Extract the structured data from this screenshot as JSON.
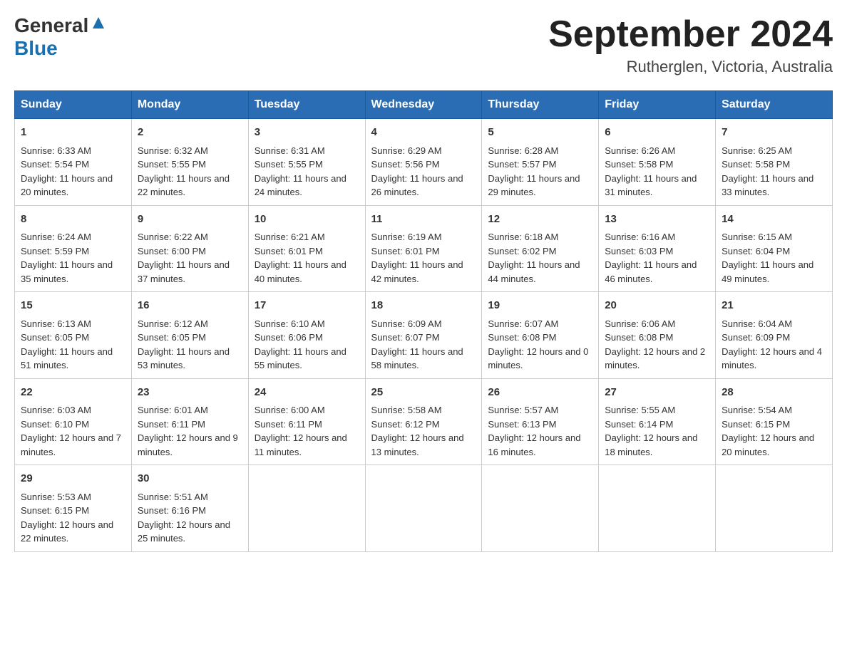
{
  "header": {
    "logo_general": "General",
    "logo_blue": "Blue",
    "month_title": "September 2024",
    "location": "Rutherglen, Victoria, Australia"
  },
  "days_of_week": [
    "Sunday",
    "Monday",
    "Tuesday",
    "Wednesday",
    "Thursday",
    "Friday",
    "Saturday"
  ],
  "weeks": [
    [
      {
        "day": "1",
        "sunrise": "6:33 AM",
        "sunset": "5:54 PM",
        "daylight": "11 hours and 20 minutes."
      },
      {
        "day": "2",
        "sunrise": "6:32 AM",
        "sunset": "5:55 PM",
        "daylight": "11 hours and 22 minutes."
      },
      {
        "day": "3",
        "sunrise": "6:31 AM",
        "sunset": "5:55 PM",
        "daylight": "11 hours and 24 minutes."
      },
      {
        "day": "4",
        "sunrise": "6:29 AM",
        "sunset": "5:56 PM",
        "daylight": "11 hours and 26 minutes."
      },
      {
        "day": "5",
        "sunrise": "6:28 AM",
        "sunset": "5:57 PM",
        "daylight": "11 hours and 29 minutes."
      },
      {
        "day": "6",
        "sunrise": "6:26 AM",
        "sunset": "5:58 PM",
        "daylight": "11 hours and 31 minutes."
      },
      {
        "day": "7",
        "sunrise": "6:25 AM",
        "sunset": "5:58 PM",
        "daylight": "11 hours and 33 minutes."
      }
    ],
    [
      {
        "day": "8",
        "sunrise": "6:24 AM",
        "sunset": "5:59 PM",
        "daylight": "11 hours and 35 minutes."
      },
      {
        "day": "9",
        "sunrise": "6:22 AM",
        "sunset": "6:00 PM",
        "daylight": "11 hours and 37 minutes."
      },
      {
        "day": "10",
        "sunrise": "6:21 AM",
        "sunset": "6:01 PM",
        "daylight": "11 hours and 40 minutes."
      },
      {
        "day": "11",
        "sunrise": "6:19 AM",
        "sunset": "6:01 PM",
        "daylight": "11 hours and 42 minutes."
      },
      {
        "day": "12",
        "sunrise": "6:18 AM",
        "sunset": "6:02 PM",
        "daylight": "11 hours and 44 minutes."
      },
      {
        "day": "13",
        "sunrise": "6:16 AM",
        "sunset": "6:03 PM",
        "daylight": "11 hours and 46 minutes."
      },
      {
        "day": "14",
        "sunrise": "6:15 AM",
        "sunset": "6:04 PM",
        "daylight": "11 hours and 49 minutes."
      }
    ],
    [
      {
        "day": "15",
        "sunrise": "6:13 AM",
        "sunset": "6:05 PM",
        "daylight": "11 hours and 51 minutes."
      },
      {
        "day": "16",
        "sunrise": "6:12 AM",
        "sunset": "6:05 PM",
        "daylight": "11 hours and 53 minutes."
      },
      {
        "day": "17",
        "sunrise": "6:10 AM",
        "sunset": "6:06 PM",
        "daylight": "11 hours and 55 minutes."
      },
      {
        "day": "18",
        "sunrise": "6:09 AM",
        "sunset": "6:07 PM",
        "daylight": "11 hours and 58 minutes."
      },
      {
        "day": "19",
        "sunrise": "6:07 AM",
        "sunset": "6:08 PM",
        "daylight": "12 hours and 0 minutes."
      },
      {
        "day": "20",
        "sunrise": "6:06 AM",
        "sunset": "6:08 PM",
        "daylight": "12 hours and 2 minutes."
      },
      {
        "day": "21",
        "sunrise": "6:04 AM",
        "sunset": "6:09 PM",
        "daylight": "12 hours and 4 minutes."
      }
    ],
    [
      {
        "day": "22",
        "sunrise": "6:03 AM",
        "sunset": "6:10 PM",
        "daylight": "12 hours and 7 minutes."
      },
      {
        "day": "23",
        "sunrise": "6:01 AM",
        "sunset": "6:11 PM",
        "daylight": "12 hours and 9 minutes."
      },
      {
        "day": "24",
        "sunrise": "6:00 AM",
        "sunset": "6:11 PM",
        "daylight": "12 hours and 11 minutes."
      },
      {
        "day": "25",
        "sunrise": "5:58 AM",
        "sunset": "6:12 PM",
        "daylight": "12 hours and 13 minutes."
      },
      {
        "day": "26",
        "sunrise": "5:57 AM",
        "sunset": "6:13 PM",
        "daylight": "12 hours and 16 minutes."
      },
      {
        "day": "27",
        "sunrise": "5:55 AM",
        "sunset": "6:14 PM",
        "daylight": "12 hours and 18 minutes."
      },
      {
        "day": "28",
        "sunrise": "5:54 AM",
        "sunset": "6:15 PM",
        "daylight": "12 hours and 20 minutes."
      }
    ],
    [
      {
        "day": "29",
        "sunrise": "5:53 AM",
        "sunset": "6:15 PM",
        "daylight": "12 hours and 22 minutes."
      },
      {
        "day": "30",
        "sunrise": "5:51 AM",
        "sunset": "6:16 PM",
        "daylight": "12 hours and 25 minutes."
      },
      null,
      null,
      null,
      null,
      null
    ]
  ],
  "labels": {
    "sunrise": "Sunrise:",
    "sunset": "Sunset:",
    "daylight": "Daylight:"
  }
}
